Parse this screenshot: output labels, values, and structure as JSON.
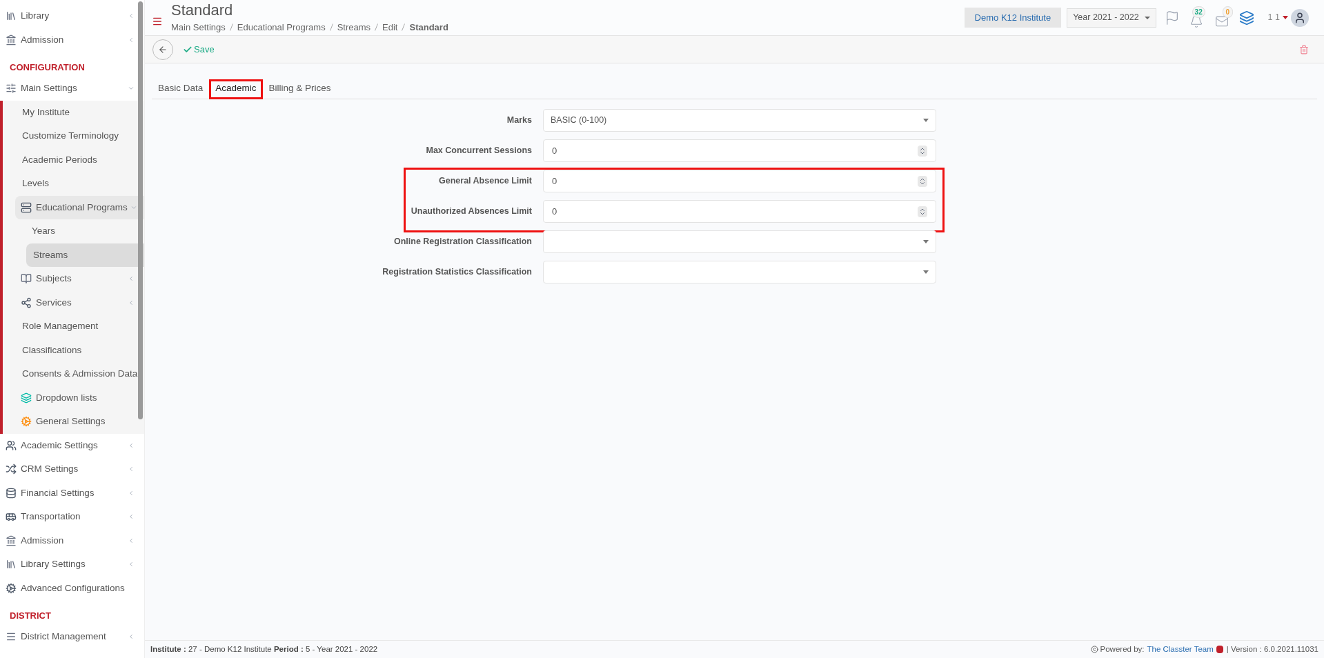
{
  "sidebar": {
    "items": [
      {
        "kind": "link",
        "label": "Library",
        "expanded": false,
        "selected": false
      },
      {
        "kind": "link",
        "label": "Admission",
        "expanded": false,
        "selected": false
      },
      {
        "kind": "section",
        "label": "CONFIGURATION"
      },
      {
        "kind": "link",
        "label": "Main Settings",
        "expanded": true,
        "selected": false,
        "children": [
          {
            "kind": "link",
            "label": "My Institute",
            "selected": false
          },
          {
            "kind": "link",
            "label": "Customize Terminology",
            "selected": false
          },
          {
            "kind": "link",
            "label": "Academic Periods",
            "selected": false
          },
          {
            "kind": "link",
            "label": "Levels",
            "selected": false
          },
          {
            "kind": "link",
            "label": "Educational Programs",
            "expanded": true,
            "selected": false,
            "children": [
              {
                "kind": "link",
                "label": "Years",
                "selected": false
              },
              {
                "kind": "link",
                "label": "Streams",
                "selected": true
              }
            ]
          },
          {
            "kind": "link",
            "label": "Subjects",
            "expanded": false,
            "selected": false
          },
          {
            "kind": "link",
            "label": "Services",
            "expanded": false,
            "selected": false
          },
          {
            "kind": "link",
            "label": "Role Management",
            "selected": false
          },
          {
            "kind": "link",
            "label": "Classifications",
            "selected": false
          },
          {
            "kind": "link",
            "label": "Consents & Admission Data",
            "selected": false
          },
          {
            "kind": "link",
            "label": "Dropdown lists",
            "selected": false
          },
          {
            "kind": "link",
            "label": "General Settings",
            "selected": false
          }
        ]
      },
      {
        "kind": "link",
        "label": "Academic Settings",
        "expanded": false,
        "selected": false
      },
      {
        "kind": "link",
        "label": "CRM Settings",
        "expanded": false,
        "selected": false
      },
      {
        "kind": "link",
        "label": "Financial Settings",
        "expanded": false,
        "selected": false
      },
      {
        "kind": "link",
        "label": "Transportation",
        "expanded": false,
        "selected": false
      },
      {
        "kind": "link",
        "label": "Admission",
        "expanded": false,
        "selected": false
      },
      {
        "kind": "link",
        "label": "Library Settings",
        "expanded": false,
        "selected": false
      },
      {
        "kind": "link",
        "label": "Advanced Configurations",
        "selected": false
      },
      {
        "kind": "section",
        "label": "DISTRICT"
      },
      {
        "kind": "link",
        "label": "District Management",
        "expanded": false,
        "selected": false
      }
    ]
  },
  "header": {
    "title": "Standard",
    "breadcrumb": [
      "Main Settings",
      "Educational Programs",
      "Streams",
      "Edit",
      "Standard"
    ],
    "institute": "Demo K12 Institute",
    "year": "Year 2021 - 2022",
    "notifications": "32",
    "messages": "0",
    "user": "1 1"
  },
  "toolbar": {
    "save": "Save"
  },
  "tabs": [
    {
      "label": "Basic Data",
      "selected": false,
      "highlighted": false
    },
    {
      "label": "Academic",
      "selected": true,
      "highlighted": true
    },
    {
      "label": "Billing & Prices",
      "selected": false,
      "highlighted": false
    }
  ],
  "form": {
    "fields": [
      {
        "kind": "select",
        "label": "Marks",
        "value": "BASIC (0-100)",
        "highlighted": false
      },
      {
        "kind": "number",
        "label": "Max Concurrent Sessions",
        "value": "0",
        "highlighted": false
      },
      {
        "kind": "number",
        "label": "General Absence Limit",
        "value": "0",
        "highlighted": true
      },
      {
        "kind": "number",
        "label": "Unauthorized Absences Limit",
        "value": "0",
        "highlighted": true
      },
      {
        "kind": "select",
        "label": "Online Registration Classification",
        "highlighted": false
      },
      {
        "kind": "select",
        "label": "Registration Statistics Classification",
        "highlighted": false
      }
    ]
  },
  "footer": {
    "info": "**Institute :** 27 - Demo K12 Institute **Period :** 5 - Year 2021 - 2022",
    "powered_by": "Powered by:",
    "team": "The Classter Team",
    "version": "| Version : 6.0.2021.11031"
  }
}
